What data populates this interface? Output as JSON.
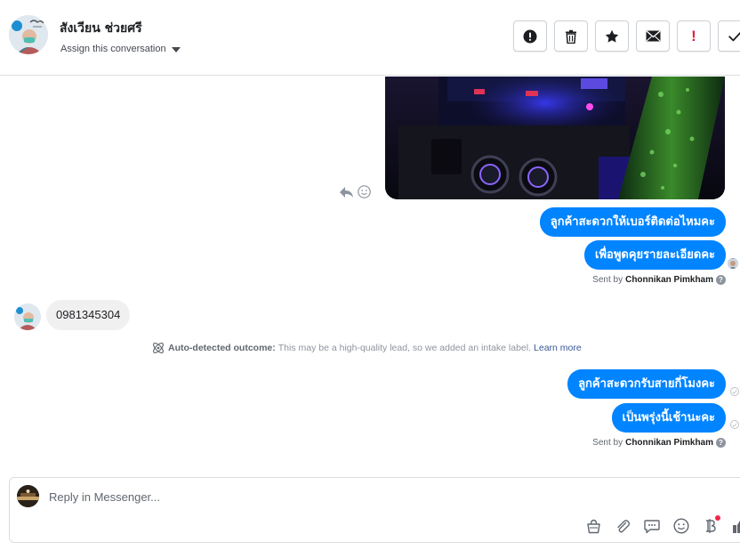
{
  "header": {
    "contact_name": "สังเวียน ช่วยศรี",
    "assign_label": "Assign this conversation",
    "actions": [
      {
        "name": "mark-spam-button",
        "icon": "alert-circle-icon"
      },
      {
        "name": "delete-button",
        "icon": "trash-icon"
      },
      {
        "name": "star-button",
        "icon": "star-icon"
      },
      {
        "name": "mark-unread-button",
        "icon": "envelope-icon"
      },
      {
        "name": "follow-up-button",
        "icon": "exclamation-icon"
      },
      {
        "name": "mark-done-button",
        "icon": "check-icon"
      }
    ],
    "follow_up_glyph": "!"
  },
  "messages": {
    "out1": "ลูกค้าสะดวกให้เบอร์ติดต่อไหมคะ",
    "out2": "เพื่อพูดคุยรายละเอียดคะ",
    "sent_by_prefix": "Sent by",
    "sent_by_name": "Chonnikan Pimkham",
    "help_glyph": "?",
    "incoming_phone": "0981345304",
    "auto_detect_title": "Auto-detected outcome:",
    "auto_detect_text": "This may be a high-quality lead, so we added an intake label.",
    "learn_more": "Learn more",
    "out3": "ลูกค้าสะดวกรับสายกี่โมงคะ",
    "out4": "เป็นพรุ่งนี้เช้านะคะ"
  },
  "composer": {
    "placeholder": "Reply in Messenger...",
    "tools": [
      "shop-bag-icon",
      "paperclip-icon",
      "saved-reply-icon",
      "emoji-icon",
      "payment-baht-icon",
      "thumbs-up-icon"
    ]
  },
  "colors": {
    "accent": "#0084ff",
    "incoming_bubble": "#f1f0f0",
    "alert_red": "#e41e3f"
  }
}
